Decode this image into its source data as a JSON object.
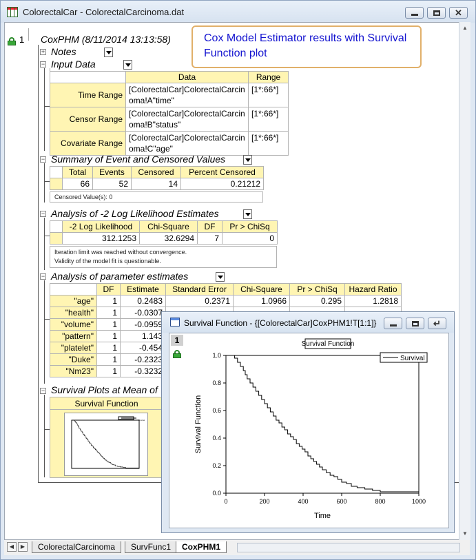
{
  "window": {
    "title": "ColorectalCar - ColorectalCarcinoma.dat"
  },
  "tree": {
    "root_index": "1",
    "root_title": "CoxPHM (8/11/2014 13:13:58)"
  },
  "callout_text": "Cox Model Estimator results with Survival Function plot",
  "sections": {
    "notes": "Notes",
    "input_data": "Input Data",
    "summary": "Summary of Event and Censored Values",
    "loglik": "Analysis of -2 Log Likelihood Estimates",
    "params": "Analysis of parameter estimates",
    "survival": "Survival Plots at Mean of"
  },
  "input_table": {
    "headers": [
      "Data",
      "Range"
    ],
    "rows": [
      {
        "label": "Time Range",
        "data1": "[ColorectalCar]ColorectalCarcin",
        "data2": "oma!A\"time\"",
        "range": "[1*:66*]"
      },
      {
        "label": "Censor Range",
        "data1": "[ColorectalCar]ColorectalCarcin",
        "data2": "oma!B\"status\"",
        "range": "[1*:66*]"
      },
      {
        "label": "Covariate Range",
        "data1": "[ColorectalCar]ColorectalCarcin",
        "data2": "oma!C\"age\"",
        "range": "[1*:66*]"
      }
    ]
  },
  "summary_table": {
    "headers": [
      "Total",
      "Events",
      "Censored",
      "Percent Censored"
    ],
    "values": [
      "66",
      "52",
      "14",
      "0.21212"
    ],
    "note": "Censored Value(s): 0"
  },
  "loglik_table": {
    "headers": [
      "-2 Log Likelihood",
      "Chi-Square",
      "DF",
      "Pr > ChiSq"
    ],
    "values": [
      "312.1253",
      "32.6294",
      "7",
      "0"
    ],
    "note1": "Iteration limit was reached without convergence.",
    "note2": "Validity of the model fit is questionable."
  },
  "params_table": {
    "headers": [
      "DF",
      "Estimate",
      "Standard Error",
      "Chi-Square",
      "Pr > ChiSq",
      "Hazard Ratio"
    ],
    "rows": [
      {
        "name": "\"age\"",
        "df": "1",
        "est": "0.2483",
        "se": "0.2371",
        "chi": "1.0966",
        "p": "0.295",
        "hr": "1.2818"
      },
      {
        "name": "\"health\"",
        "df": "1",
        "est": "-0.0307"
      },
      {
        "name": "\"volume\"",
        "df": "1",
        "est": "-0.0959"
      },
      {
        "name": "\"pattern\"",
        "df": "1",
        "est": "1.143"
      },
      {
        "name": "\"platelet\"",
        "df": "1",
        "est": "-0.454"
      },
      {
        "name": "\"Duke\"",
        "df": "1",
        "est": "-0.2323"
      },
      {
        "name": "\"Nm23\"",
        "df": "1",
        "est": "-0.3232"
      }
    ]
  },
  "survival_header": "Survival Function",
  "sheet_tabs": [
    "ColorectalCarcinoma",
    "SurvFunc1",
    "CoxPHM1"
  ],
  "graph_window": {
    "title": "Survival Function - {[ColorectalCar]CoxPHM1!T[1:1]}",
    "layer": "1"
  },
  "colors": {
    "header_fill": "#fff5b3",
    "callout_border": "#e1b06a",
    "callout_text": "#1515d0"
  },
  "chart_data": {
    "type": "line",
    "title": "Survival Function",
    "xlabel": "Time",
    "ylabel": "Survival Function",
    "xlim": [
      0,
      1000
    ],
    "ylim": [
      0.0,
      1.0
    ],
    "xticks": [
      "0",
      "200",
      "400",
      "600",
      "800",
      "1000"
    ],
    "yticks": [
      "0.0",
      "0.2",
      "0.4",
      "0.6",
      "0.8",
      "1.0"
    ],
    "grid": false,
    "legend": "top-right",
    "series": [
      {
        "name": "Survival",
        "step": true,
        "x": [
          0,
          45,
          60,
          75,
          90,
          100,
          110,
          125,
          140,
          155,
          170,
          185,
          200,
          215,
          230,
          245,
          260,
          275,
          290,
          305,
          320,
          335,
          350,
          365,
          380,
          395,
          410,
          425,
          440,
          455,
          470,
          485,
          500,
          520,
          540,
          560,
          580,
          600,
          625,
          650,
          680,
          720,
          760,
          800,
          1000
        ],
        "y": [
          1.0,
          0.98,
          0.95,
          0.92,
          0.89,
          0.86,
          0.83,
          0.8,
          0.77,
          0.74,
          0.71,
          0.68,
          0.65,
          0.62,
          0.59,
          0.56,
          0.53,
          0.51,
          0.48,
          0.46,
          0.43,
          0.41,
          0.39,
          0.36,
          0.34,
          0.32,
          0.3,
          0.27,
          0.25,
          0.23,
          0.21,
          0.19,
          0.17,
          0.15,
          0.13,
          0.12,
          0.1,
          0.08,
          0.07,
          0.05,
          0.04,
          0.03,
          0.02,
          0.01,
          0.0
        ]
      }
    ]
  }
}
